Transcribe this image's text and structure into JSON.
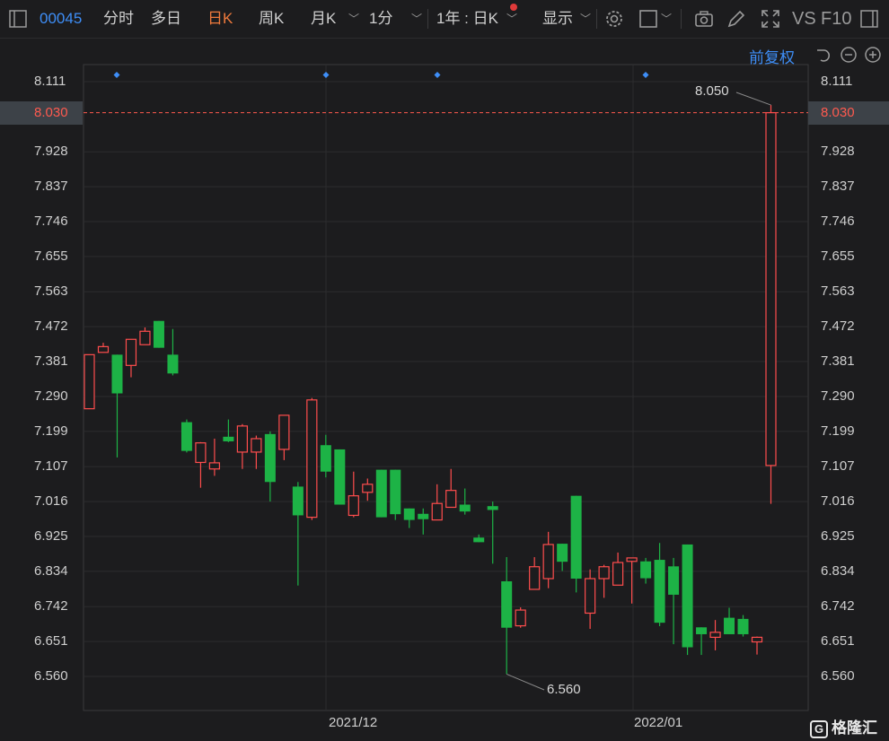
{
  "toolbar": {
    "stock_code": "00045",
    "tabs": [
      "分时",
      "多日",
      "日K",
      "周K",
      "月K",
      "1分"
    ],
    "active_tab": "日K",
    "range_select": "1年 : 日K",
    "display_label": "显示",
    "vs_label": "VS",
    "f10_label": "F10"
  },
  "chart": {
    "adjust_label": "前复权",
    "current_price": "8.030",
    "y_ticks": [
      "8.111",
      "7.928",
      "7.837",
      "7.746",
      "7.655",
      "7.563",
      "7.472",
      "7.381",
      "7.290",
      "7.199",
      "7.107",
      "7.016",
      "6.925",
      "6.834",
      "6.742",
      "6.651",
      "6.560"
    ],
    "x_ticks": [
      "2021/12",
      "2022/01"
    ],
    "high_annotation": "8.050",
    "low_annotation": "6.560",
    "watermark": "格隆汇",
    "colors": {
      "up": "#ff4d4d",
      "down": "#1db346",
      "current_line": "#ff5a4f",
      "marker": "#3e8ef7"
    }
  },
  "chart_data": {
    "type": "candlestick",
    "ylim": [
      6.56,
      8.111
    ],
    "x_ticks": [
      "2021/12",
      "2022/01"
    ],
    "candles": [
      {
        "o": 7.258,
        "h": 7.399,
        "l": 7.258,
        "c": 7.399
      },
      {
        "o": 7.405,
        "h": 7.43,
        "l": 7.405,
        "c": 7.42
      },
      {
        "o": 7.399,
        "h": 7.399,
        "l": 7.131,
        "c": 7.298
      },
      {
        "o": 7.371,
        "h": 7.439,
        "l": 7.34,
        "c": 7.439
      },
      {
        "o": 7.425,
        "h": 7.47,
        "l": 7.425,
        "c": 7.46
      },
      {
        "o": 7.487,
        "h": 7.487,
        "l": 7.417,
        "c": 7.417
      },
      {
        "o": 7.399,
        "h": 7.466,
        "l": 7.345,
        "c": 7.35
      },
      {
        "o": 7.223,
        "h": 7.23,
        "l": 7.144,
        "c": 7.148
      },
      {
        "o": 7.118,
        "h": 7.171,
        "l": 7.052,
        "c": 7.169
      },
      {
        "o": 7.101,
        "h": 7.18,
        "l": 7.083,
        "c": 7.117
      },
      {
        "o": 7.185,
        "h": 7.23,
        "l": 7.171,
        "c": 7.173
      },
      {
        "o": 7.145,
        "h": 7.218,
        "l": 7.101,
        "c": 7.213
      },
      {
        "o": 7.145,
        "h": 7.188,
        "l": 7.101,
        "c": 7.18
      },
      {
        "o": 7.192,
        "h": 7.199,
        "l": 7.016,
        "c": 7.067
      },
      {
        "o": 7.152,
        "h": 7.23,
        "l": 7.124,
        "c": 7.241
      },
      {
        "o": 7.055,
        "h": 7.067,
        "l": 6.797,
        "c": 6.98
      },
      {
        "o": 6.975,
        "h": 7.286,
        "l": 6.968,
        "c": 7.281
      },
      {
        "o": 7.163,
        "h": 7.19,
        "l": 7.079,
        "c": 7.094
      },
      {
        "o": 7.152,
        "h": 7.152,
        "l": 7.008,
        "c": 7.008
      },
      {
        "o": 6.98,
        "h": 7.094,
        "l": 6.975,
        "c": 7.031
      },
      {
        "o": 7.04,
        "h": 7.076,
        "l": 7.018,
        "c": 7.061
      },
      {
        "o": 7.099,
        "h": 7.099,
        "l": 6.975,
        "c": 6.975
      },
      {
        "o": 7.099,
        "h": 7.099,
        "l": 6.968,
        "c": 6.983
      },
      {
        "o": 6.998,
        "h": 6.998,
        "l": 6.947,
        "c": 6.968
      },
      {
        "o": 6.984,
        "h": 6.998,
        "l": 6.93,
        "c": 6.97
      },
      {
        "o": 6.968,
        "h": 7.061,
        "l": 6.968,
        "c": 7.011
      },
      {
        "o": 7.001,
        "h": 7.101,
        "l": 7.001,
        "c": 7.045
      },
      {
        "o": 7.008,
        "h": 7.05,
        "l": 6.982,
        "c": 6.99
      },
      {
        "o": 6.922,
        "h": 6.93,
        "l": 6.91,
        "c": 6.91
      },
      {
        "o": 7.004,
        "h": 7.016,
        "l": 6.854,
        "c": 6.994
      },
      {
        "o": 6.808,
        "h": 6.871,
        "l": 6.566,
        "c": 6.687
      },
      {
        "o": 6.692,
        "h": 6.74,
        "l": 6.687,
        "c": 6.733
      },
      {
        "o": 6.787,
        "h": 6.871,
        "l": 6.787,
        "c": 6.846
      },
      {
        "o": 6.815,
        "h": 6.937,
        "l": 6.79,
        "c": 6.904
      },
      {
        "o": 6.906,
        "h": 6.906,
        "l": 6.835,
        "c": 6.859
      },
      {
        "o": 7.031,
        "h": 7.031,
        "l": 6.779,
        "c": 6.815
      },
      {
        "o": 6.725,
        "h": 6.839,
        "l": 6.684,
        "c": 6.815
      },
      {
        "o": 6.815,
        "h": 6.851,
        "l": 6.765,
        "c": 6.846
      },
      {
        "o": 6.798,
        "h": 6.883,
        "l": 6.798,
        "c": 6.857
      },
      {
        "o": 6.86,
        "h": 6.869,
        "l": 6.75,
        "c": 6.869
      },
      {
        "o": 6.86,
        "h": 6.869,
        "l": 6.802,
        "c": 6.816
      },
      {
        "o": 6.864,
        "h": 6.908,
        "l": 6.691,
        "c": 6.7
      },
      {
        "o": 6.847,
        "h": 6.869,
        "l": 6.644,
        "c": 6.773
      },
      {
        "o": 6.904,
        "h": 6.904,
        "l": 6.616,
        "c": 6.636
      },
      {
        "o": 6.688,
        "h": 6.688,
        "l": 6.616,
        "c": 6.67
      },
      {
        "o": 6.662,
        "h": 6.707,
        "l": 6.628,
        "c": 6.675
      },
      {
        "o": 6.713,
        "h": 6.739,
        "l": 6.67,
        "c": 6.67
      },
      {
        "o": 6.71,
        "h": 6.72,
        "l": 6.664,
        "c": 6.67
      },
      {
        "o": 6.65,
        "h": 6.664,
        "l": 6.617,
        "c": 6.662
      },
      {
        "o": 7.11,
        "h": 8.05,
        "l": 7.01,
        "c": 8.03
      }
    ]
  }
}
